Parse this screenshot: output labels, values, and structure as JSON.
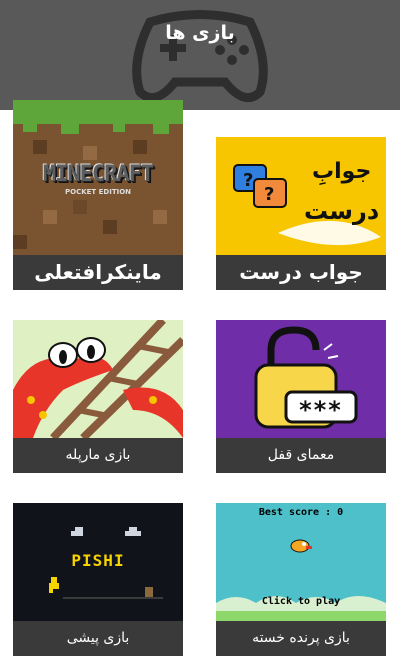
{
  "header": {
    "title": "بازی ها"
  },
  "games": [
    {
      "label": "جواب درست",
      "thumb_text_line1": "جوابِ",
      "thumb_text_line2": "درست"
    },
    {
      "label": "ماینکرافتعلی",
      "thumb_title": "MINECRAFT",
      "thumb_subtitle": "POCKET EDITION"
    },
    {
      "label": "معمای قفل",
      "thumb_password": "***"
    },
    {
      "label": "بازی مارپله"
    },
    {
      "label": "بازی پرنده خسته",
      "thumb_score": "Best score : 0",
      "thumb_prompt": "Click to play"
    },
    {
      "label": "بازی پیشی",
      "thumb_title": "PISHI"
    }
  ],
  "colors": {
    "header_bg": "#595959",
    "label_bg": "#3a3a3a",
    "yellow": "#f7c600",
    "purple": "#6f2da8",
    "sky": "#4ec0ca",
    "night": "#10131a"
  }
}
